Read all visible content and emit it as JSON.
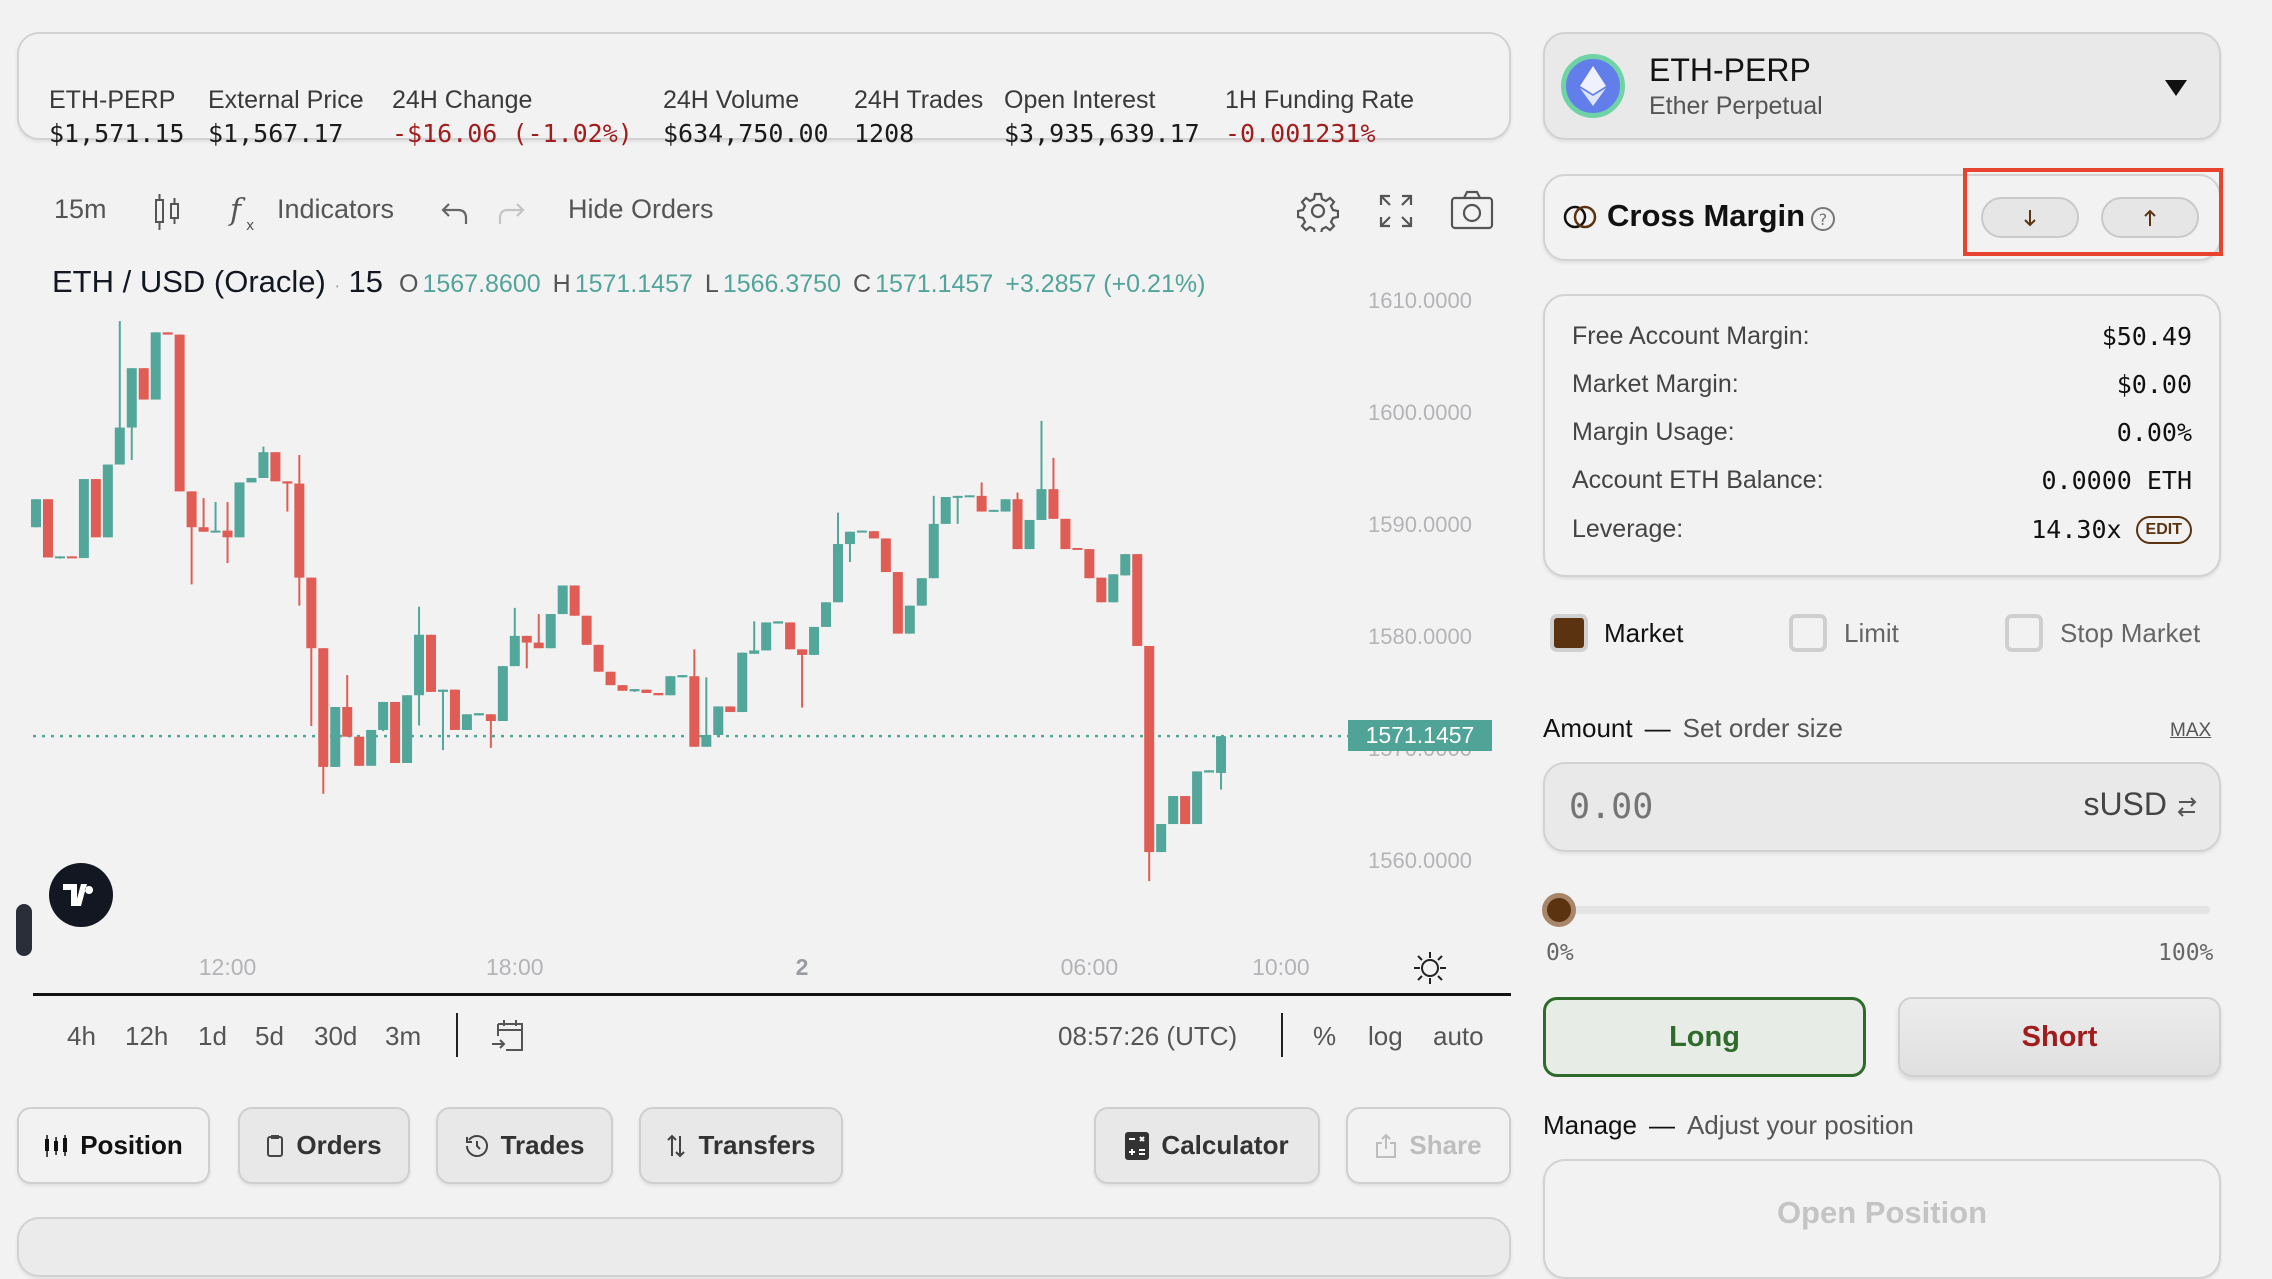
{
  "stats": [
    {
      "label": "ETH-PERP",
      "value": "$1,571.15",
      "negative": false
    },
    {
      "label": "External Price",
      "value": "$1,567.17",
      "negative": false
    },
    {
      "label": "24H Change",
      "value": "-$16.06 (-1.02%)",
      "negative": true
    },
    {
      "label": "24H Volume",
      "value": "$634,750.00",
      "negative": false
    },
    {
      "label": "24H Trades",
      "value": "1208",
      "negative": false
    },
    {
      "label": "Open Interest",
      "value": "$3,935,639.17",
      "negative": false
    },
    {
      "label": "1H Funding Rate",
      "value": "-0.001231%",
      "negative": true
    }
  ],
  "toolbar": {
    "interval": "15m",
    "indicators": "Indicators",
    "hide_orders": "Hide Orders"
  },
  "legend": {
    "symbol": "ETH / USD (Oracle)",
    "sep": "·",
    "interval": "15",
    "o_label": "O",
    "o": "1567.8600",
    "h_label": "H",
    "h": "1571.1457",
    "l_label": "L",
    "l": "1566.3750",
    "c_label": "C",
    "c": "1571.1457",
    "change": "+3.2857 (+0.21%)"
  },
  "bottom_toolbar": {
    "ranges": [
      "4h",
      "12h",
      "1d",
      "5d",
      "30d",
      "3m"
    ],
    "time": "08:57:26 (UTC)",
    "percent": "%",
    "log": "log",
    "auto": "auto"
  },
  "tabs": {
    "position": "Position",
    "orders": "Orders",
    "trades": "Trades",
    "transfers": "Transfers",
    "calculator": "Calculator",
    "share": "Share"
  },
  "market": {
    "symbol": "ETH-PERP",
    "name": "Ether Perpetual"
  },
  "margin": {
    "title": "Cross Margin"
  },
  "account": {
    "rows": [
      {
        "label": "Free Account Margin:",
        "value": "$50.49"
      },
      {
        "label": "Market Margin:",
        "value": "$0.00"
      },
      {
        "label": "Margin Usage:",
        "value": "0.00%"
      },
      {
        "label": "Account ETH Balance:",
        "value": "0.0000 ETH"
      },
      {
        "label": "Leverage:",
        "value": "14.30x"
      }
    ],
    "edit": "EDIT"
  },
  "order_types": [
    {
      "label": "Market",
      "checked": true
    },
    {
      "label": "Limit",
      "checked": false
    },
    {
      "label": "Stop Market",
      "checked": false
    }
  ],
  "amount": {
    "title": "Amount",
    "dash": "—",
    "subtitle": "Set order size",
    "max": "MAX",
    "placeholder": "0.00",
    "currency": "sUSD"
  },
  "slider": {
    "value_percent": 0,
    "min_label": "0%",
    "max_label": "100%"
  },
  "actions": {
    "long": "Long",
    "short": "Short"
  },
  "manage": {
    "title": "Manage",
    "dash": "—",
    "subtitle": "Adjust your position",
    "open_position": "Open Position"
  },
  "colors": {
    "up": "#53a69a",
    "down": "#e05d56",
    "negative_text": "#a11d1d",
    "accent_brown": "#5c3310",
    "long_green": "#2f6b2a",
    "price_tag": "#4fa497"
  },
  "chart_data": {
    "type": "candlestick",
    "interval": "15m",
    "last_price": "1571.1457",
    "last_price_value": 1571.1457,
    "ylim": [
      1555,
      1612
    ],
    "y_ticks": [
      {
        "value": 1610,
        "label": "1610.0000"
      },
      {
        "value": 1600,
        "label": "1600.0000"
      },
      {
        "value": 1590,
        "label": "1590.0000"
      },
      {
        "value": 1580,
        "label": "1580.0000"
      },
      {
        "value": 1570,
        "label": "1570.0000"
      },
      {
        "value": 1560,
        "label": "1560.0000"
      }
    ],
    "x_ticks": [
      {
        "label": "12:00",
        "time": "12:00",
        "bold": false
      },
      {
        "label": "18:00",
        "time": "18:00",
        "bold": false
      },
      {
        "label": "2",
        "time": "00:00",
        "bold": true
      },
      {
        "label": "06:00",
        "time": "06:00",
        "bold": false
      },
      {
        "label": "10:00",
        "time": "10:00",
        "bold": false
      }
    ],
    "columns": [
      "time",
      "open",
      "high",
      "low",
      "close"
    ],
    "candles": [
      [
        "08:00",
        1589.8,
        1592.3,
        1589.8,
        1592.3
      ],
      [
        "08:15",
        1592.3,
        1592.3,
        1587.1,
        1587.1
      ],
      [
        "08:30",
        1587.1,
        1587.2,
        1587.0,
        1587.2
      ],
      [
        "08:45",
        1587.2,
        1587.2,
        1587.05,
        1587.05
      ],
      [
        "09:00",
        1587.05,
        1594.1,
        1587.05,
        1594.1
      ],
      [
        "09:15",
        1594.1,
        1594.1,
        1588.9,
        1588.9
      ],
      [
        "09:30",
        1588.9,
        1595.4,
        1588.9,
        1595.4
      ],
      [
        "09:45",
        1595.4,
        1608.2,
        1595.4,
        1598.7
      ],
      [
        "10:00",
        1598.7,
        1604.0,
        1595.8,
        1604.0
      ],
      [
        "10:15",
        1604.0,
        1604.0,
        1601.2,
        1601.2
      ],
      [
        "10:30",
        1601.2,
        1607.2,
        1601.2,
        1607.2
      ],
      [
        "10:45",
        1607.2,
        1607.2,
        1607.0,
        1607.0
      ],
      [
        "11:00",
        1607.0,
        1607.0,
        1593.0,
        1593.0
      ],
      [
        "11:15",
        1593.0,
        1593.0,
        1584.7,
        1589.8
      ],
      [
        "11:30",
        1589.8,
        1592.4,
        1589.4,
        1589.4
      ],
      [
        "11:45",
        1589.4,
        1592.05,
        1589.4,
        1589.5
      ],
      [
        "12:00",
        1589.5,
        1592.05,
        1586.6,
        1588.9
      ],
      [
        "12:15",
        1588.9,
        1593.8,
        1588.9,
        1593.8
      ],
      [
        "12:30",
        1593.8,
        1594.2,
        1593.8,
        1594.2
      ],
      [
        "12:45",
        1594.2,
        1597.0,
        1594.2,
        1596.5
      ],
      [
        "13:00",
        1596.5,
        1596.5,
        1593.9,
        1593.9
      ],
      [
        "13:15",
        1593.9,
        1593.9,
        1591.2,
        1593.7
      ],
      [
        "13:30",
        1593.7,
        1596.25,
        1582.8,
        1585.3
      ],
      [
        "13:45",
        1585.3,
        1585.3,
        1572.05,
        1579.0
      ],
      [
        "14:00",
        1579.0,
        1579.0,
        1566.0,
        1568.4
      ],
      [
        "14:15",
        1568.4,
        1573.75,
        1568.4,
        1573.75
      ],
      [
        "14:30",
        1573.75,
        1576.6,
        1571.1,
        1571.1
      ],
      [
        "14:45",
        1571.1,
        1571.1,
        1568.5,
        1568.5
      ],
      [
        "15:00",
        1568.5,
        1571.7,
        1568.5,
        1571.7
      ],
      [
        "15:15",
        1571.7,
        1574.2,
        1571.6,
        1574.2
      ],
      [
        "15:30",
        1574.2,
        1574.2,
        1568.75,
        1568.75
      ],
      [
        "15:45",
        1568.75,
        1574.8,
        1568.75,
        1574.8
      ],
      [
        "16:00",
        1574.8,
        1582.7,
        1572.1,
        1580.2
      ],
      [
        "16:15",
        1580.2,
        1580.2,
        1575.1,
        1575.1
      ],
      [
        "16:30",
        1575.1,
        1575.3,
        1569.9,
        1575.3
      ],
      [
        "16:45",
        1575.3,
        1575.3,
        1571.7,
        1571.7
      ],
      [
        "17:00",
        1571.7,
        1573.1,
        1571.7,
        1573.1
      ],
      [
        "17:15",
        1573.0,
        1573.2,
        1573.0,
        1573.2
      ],
      [
        "17:30",
        1573.1,
        1573.1,
        1570.1,
        1572.5
      ],
      [
        "17:45",
        1572.5,
        1577.4,
        1572.5,
        1577.4
      ],
      [
        "18:00",
        1577.4,
        1582.6,
        1577.4,
        1580.1
      ],
      [
        "18:15",
        1580.1,
        1580.1,
        1577.2,
        1579.5
      ],
      [
        "18:30",
        1579.5,
        1582.05,
        1579.0,
        1579.0
      ],
      [
        "18:45",
        1579.0,
        1582.05,
        1579.0,
        1582.05
      ],
      [
        "19:00",
        1582.05,
        1584.6,
        1582.05,
        1584.6
      ],
      [
        "19:15",
        1584.6,
        1584.6,
        1581.9,
        1581.9
      ],
      [
        "19:30",
        1581.9,
        1581.9,
        1579.3,
        1579.3
      ],
      [
        "19:45",
        1579.3,
        1579.3,
        1576.9,
        1576.9
      ],
      [
        "20:00",
        1576.9,
        1576.9,
        1575.7,
        1575.7
      ],
      [
        "20:15",
        1575.7,
        1575.7,
        1575.2,
        1575.2
      ],
      [
        "20:30",
        1575.15,
        1575.35,
        1575.1,
        1575.35
      ],
      [
        "20:45",
        1575.3,
        1575.3,
        1575.0,
        1575.0
      ],
      [
        "21:00",
        1575.0,
        1575.0,
        1574.8,
        1574.8
      ],
      [
        "21:15",
        1574.8,
        1576.5,
        1574.8,
        1576.5
      ],
      [
        "21:30",
        1576.4,
        1576.6,
        1576.4,
        1576.6
      ],
      [
        "21:45",
        1576.5,
        1578.9,
        1570.2,
        1570.2
      ],
      [
        "22:00",
        1570.2,
        1576.4,
        1570.2,
        1571.25
      ],
      [
        "22:15",
        1571.25,
        1573.8,
        1571.25,
        1573.8
      ],
      [
        "22:30",
        1573.8,
        1573.8,
        1573.3,
        1573.3
      ],
      [
        "22:45",
        1573.3,
        1578.6,
        1573.3,
        1578.6
      ],
      [
        "23:00",
        1578.5,
        1581.4,
        1578.5,
        1578.8
      ],
      [
        "23:15",
        1578.8,
        1581.3,
        1578.8,
        1581.3
      ],
      [
        "23:30",
        1581.2,
        1581.4,
        1581.2,
        1581.4
      ],
      [
        "23:45",
        1581.3,
        1581.3,
        1578.9,
        1578.9
      ],
      [
        "00:00",
        1578.9,
        1578.9,
        1573.7,
        1578.4
      ],
      [
        "00:15",
        1578.4,
        1580.9,
        1578.4,
        1580.9
      ],
      [
        "00:30",
        1580.9,
        1583.1,
        1580.9,
        1583.1
      ],
      [
        "00:45",
        1583.1,
        1591.1,
        1583.1,
        1588.3
      ],
      [
        "01:00",
        1588.3,
        1589.4,
        1586.7,
        1589.4
      ],
      [
        "01:15",
        1589.4,
        1589.5,
        1589.4,
        1589.5
      ],
      [
        "01:30",
        1589.45,
        1589.45,
        1588.8,
        1588.8
      ],
      [
        "01:45",
        1588.8,
        1588.8,
        1585.8,
        1585.8
      ],
      [
        "02:00",
        1585.8,
        1585.8,
        1580.3,
        1580.3
      ],
      [
        "02:15",
        1580.3,
        1582.8,
        1580.3,
        1582.8
      ],
      [
        "02:30",
        1582.8,
        1585.25,
        1582.8,
        1585.25
      ],
      [
        "02:45",
        1585.25,
        1592.6,
        1585.25,
        1590.1
      ],
      [
        "03:00",
        1590.1,
        1592.5,
        1590.1,
        1592.5
      ],
      [
        "03:15",
        1592.5,
        1592.6,
        1590.1,
        1592.6
      ],
      [
        "03:30",
        1592.5,
        1592.65,
        1592.5,
        1592.65
      ],
      [
        "03:45",
        1592.6,
        1593.8,
        1591.2,
        1591.2
      ],
      [
        "04:00",
        1591.2,
        1591.35,
        1591.2,
        1591.35
      ],
      [
        "04:15",
        1591.2,
        1592.3,
        1591.2,
        1592.3
      ],
      [
        "04:30",
        1592.3,
        1592.9,
        1587.85,
        1587.85
      ],
      [
        "04:45",
        1587.85,
        1590.45,
        1587.85,
        1590.45
      ],
      [
        "05:00",
        1590.45,
        1599.3,
        1590.45,
        1593.2
      ],
      [
        "05:15",
        1593.2,
        1596.0,
        1590.55,
        1590.55
      ],
      [
        "05:30",
        1590.55,
        1590.55,
        1587.85,
        1587.85
      ],
      [
        "05:45",
        1587.95,
        1587.95,
        1587.8,
        1587.8
      ],
      [
        "06:00",
        1587.85,
        1587.85,
        1585.25,
        1585.25
      ],
      [
        "06:15",
        1585.3,
        1585.3,
        1583.1,
        1583.1
      ],
      [
        "06:30",
        1583.1,
        1585.6,
        1583.1,
        1585.6
      ],
      [
        "06:45",
        1585.5,
        1587.4,
        1585.5,
        1587.4
      ],
      [
        "07:00",
        1587.4,
        1587.4,
        1579.2,
        1579.2
      ],
      [
        "07:15",
        1579.2,
        1579.2,
        1558.2,
        1560.8
      ],
      [
        "07:30",
        1560.8,
        1563.3,
        1560.8,
        1563.3
      ],
      [
        "07:45",
        1563.3,
        1565.8,
        1563.3,
        1565.8
      ],
      [
        "08:00",
        1565.8,
        1565.8,
        1563.3,
        1563.3
      ],
      [
        "08:15",
        1563.3,
        1568.0,
        1563.3,
        1568.0
      ],
      [
        "08:30",
        1567.9,
        1568.1,
        1567.9,
        1568.1
      ],
      [
        "08:45",
        1567.86,
        1571.1457,
        1566.375,
        1571.1457
      ]
    ]
  }
}
